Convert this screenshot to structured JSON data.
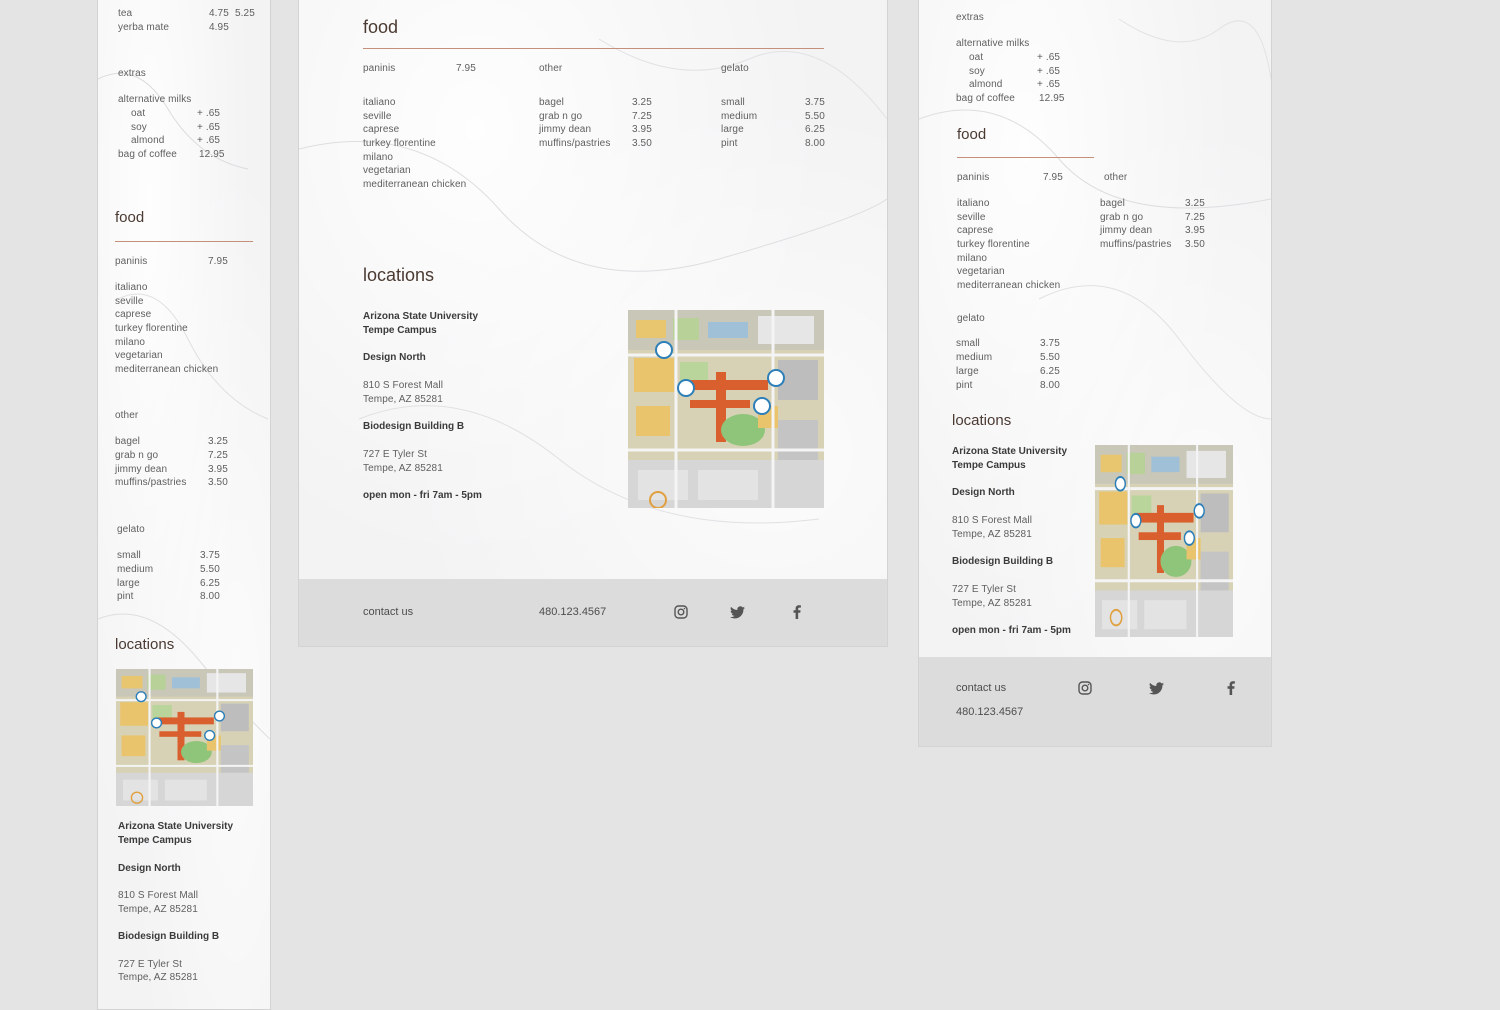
{
  "drinks": {
    "tea": {
      "name": "tea",
      "price1": "4.75",
      "price2": "5.25"
    },
    "yerba": {
      "name": "yerba mate",
      "price1": "4.95"
    }
  },
  "extras": {
    "heading": "extras",
    "alt_milks": "alternative milks",
    "oat": "oat",
    "oat_price": "+ .65",
    "soy": "soy",
    "soy_price": "+ .65",
    "almond": "almond",
    "almond_price": "+ .65",
    "bag": "bag of coffee",
    "bag_price": "12.95"
  },
  "food": {
    "title": "food",
    "paninis": {
      "label": "paninis",
      "price": "7.95",
      "items": [
        "italiano",
        "seville",
        "caprese",
        "turkey florentine",
        "milano",
        "vegetarian",
        "mediterranean chicken"
      ]
    },
    "other": {
      "label": "other",
      "items": [
        {
          "name": "bagel",
          "price": "3.25"
        },
        {
          "name": "grab n go",
          "price": "7.25"
        },
        {
          "name": "jimmy dean",
          "price": "3.95"
        },
        {
          "name": "muffins/pastries",
          "price": "3.50"
        }
      ]
    },
    "gelato": {
      "label": "gelato",
      "items": [
        {
          "name": "small",
          "price": "3.75"
        },
        {
          "name": "medium",
          "price": "5.50"
        },
        {
          "name": "large",
          "price": "6.25"
        },
        {
          "name": "pint",
          "price": "8.00"
        }
      ]
    }
  },
  "locations": {
    "title": "locations",
    "campus_line1": "Arizona State University",
    "campus_line2": "Tempe Campus",
    "loc1_name": "Design North",
    "loc1_addr1": "810 S Forest Mall",
    "loc1_addr2": "Tempe, AZ 85281",
    "loc2_name": "Biodesign Building B",
    "loc2_addr1": "727 E Tyler St",
    "loc2_addr2": "Tempe, AZ 85281",
    "hours": "open mon - fri 7am - 5pm"
  },
  "contact": {
    "label": "contact us",
    "phone": "480.123.4567",
    "icons": [
      "instagram-icon",
      "twitter-icon",
      "facebook-icon"
    ]
  },
  "colors": {
    "accent_rule": "#c4907c",
    "heading": "#4a3a32",
    "footer_bg": "#dcdcdc",
    "page_bg": "#e4e4e4"
  }
}
